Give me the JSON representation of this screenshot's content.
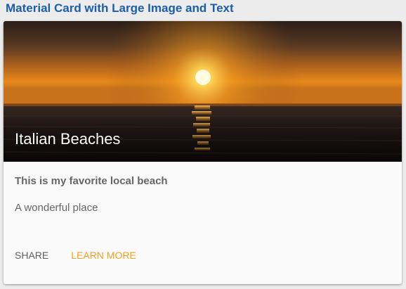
{
  "page": {
    "title": "Material Card with Large Image and Text"
  },
  "card": {
    "image_alt": "sunset over the sea",
    "title": "Italian Beaches",
    "subtitle": "This is my favorite local beach",
    "text": "A wonderful place",
    "actions": {
      "share_label": "SHARE",
      "learn_more_label": "LEARN MORE"
    }
  },
  "colors": {
    "page_title": "#1d5ea8",
    "accent_action": "#f0a020",
    "secondary_action": "#5f5f5f",
    "body_text": "#666666"
  }
}
